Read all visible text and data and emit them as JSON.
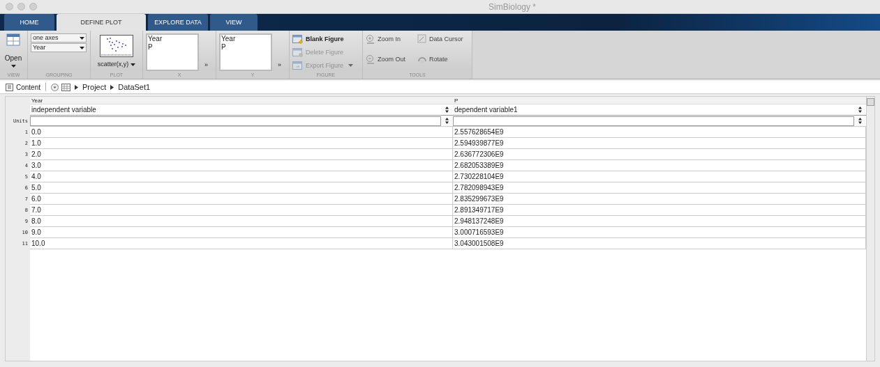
{
  "window": {
    "title": "SimBiology *"
  },
  "tabs": [
    {
      "label": "HOME",
      "selected": false
    },
    {
      "label": "DEFINE PLOT",
      "selected": true
    },
    {
      "label": "EXPLORE DATA",
      "selected": false
    },
    {
      "label": "VIEW",
      "selected": false
    }
  ],
  "ribbon": {
    "view": {
      "open_label": "Open",
      "section": "VIEW"
    },
    "grouping": {
      "dropdowns": [
        "one axes",
        "Year"
      ],
      "section": "GROUPING"
    },
    "plot": {
      "type_label": "scatter(x,y)",
      "section": "PLOT"
    },
    "x": {
      "items": [
        "Year",
        "P"
      ],
      "more": "»",
      "section": "X"
    },
    "y": {
      "items": [
        "Year",
        "P"
      ],
      "more": "»",
      "section": "Y"
    },
    "figure": {
      "buttons": [
        {
          "label": "Blank Figure",
          "kind": "blank",
          "disabled": false
        },
        {
          "label": "Delete Figure",
          "kind": "delete",
          "disabled": true
        },
        {
          "label": "Export Figure",
          "kind": "export",
          "disabled": true
        }
      ],
      "section": "FIGURE"
    },
    "tools": {
      "buttons": [
        {
          "label": "Zoom In",
          "kind": "zoomin"
        },
        {
          "label": "Data Cursor",
          "kind": "cursor"
        },
        {
          "label": "Zoom Out",
          "kind": "zoomout"
        },
        {
          "label": "Rotate",
          "kind": "rotate"
        }
      ],
      "section": "TOOLS"
    }
  },
  "breadcrumb": {
    "content_label": "Content",
    "path": [
      "Project",
      "DataSet1"
    ]
  },
  "table": {
    "units_label": "Units",
    "columns": [
      {
        "name": "Year",
        "type": "independent variable"
      },
      {
        "name": "P",
        "type": "dependent variable1"
      }
    ],
    "rows": [
      {
        "number": "1",
        "cells": [
          "0.0",
          "2.557628654E9"
        ]
      },
      {
        "number": "2",
        "cells": [
          "1.0",
          "2.594939877E9"
        ]
      },
      {
        "number": "3",
        "cells": [
          "2.0",
          "2.636772306E9"
        ]
      },
      {
        "number": "4",
        "cells": [
          "3.0",
          "2.682053389E9"
        ]
      },
      {
        "number": "5",
        "cells": [
          "4.0",
          "2.730228104E9"
        ]
      },
      {
        "number": "6",
        "cells": [
          "5.0",
          "2.782098943E9"
        ]
      },
      {
        "number": "7",
        "cells": [
          "6.0",
          "2.835299673E9"
        ]
      },
      {
        "number": "8",
        "cells": [
          "7.0",
          "2.891349717E9"
        ]
      },
      {
        "number": "9",
        "cells": [
          "8.0",
          "2.948137248E9"
        ]
      },
      {
        "number": "10",
        "cells": [
          "9.0",
          "3.000716593E9"
        ]
      },
      {
        "number": "11",
        "cells": [
          "10.0",
          "3.043001508E9"
        ]
      }
    ]
  }
}
